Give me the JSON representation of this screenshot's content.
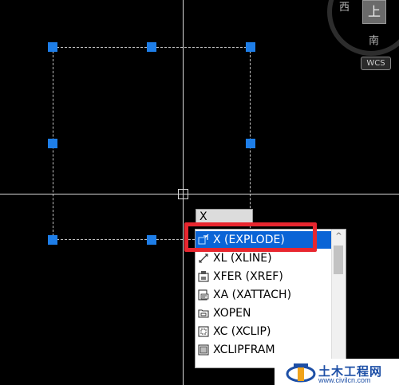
{
  "viewcube": {
    "west_label": "西",
    "top_label": "上",
    "south_label": "南",
    "wcs_label": "WCS"
  },
  "command_line": {
    "value": "X"
  },
  "autocomplete": {
    "items": [
      {
        "label": "X (EXPLODE)",
        "icon": "explode-icon",
        "selected": true
      },
      {
        "label": "XL (XLINE)",
        "icon": "xline-icon",
        "selected": false
      },
      {
        "label": "XFER (XREF)",
        "icon": "xref-icon",
        "selected": false
      },
      {
        "label": "XA (XATTACH)",
        "icon": "xattach-icon",
        "selected": false
      },
      {
        "label": "XOPEN",
        "icon": "xopen-icon",
        "selected": false
      },
      {
        "label": "XC (XCLIP)",
        "icon": "xclip-icon",
        "selected": false
      },
      {
        "label": "XCLIPFRAM",
        "icon": "xclipframe-icon",
        "selected": false
      }
    ],
    "scroll_up_glyph": "^"
  },
  "colors": {
    "grip": "#1e7ee8",
    "selection": "#0a64d6",
    "highlight": "#e8262f"
  }
}
